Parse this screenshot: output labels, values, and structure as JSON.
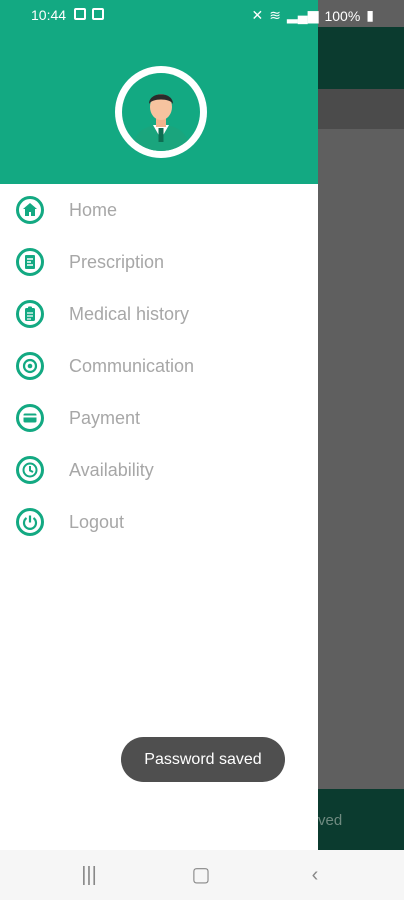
{
  "statusbar": {
    "time": "10:44",
    "battery": "100%"
  },
  "drawer": {
    "menu": [
      {
        "label": "Home",
        "icon": "home-icon"
      },
      {
        "label": "Prescription",
        "icon": "prescription-icon"
      },
      {
        "label": "Medical history",
        "icon": "medical-history-icon"
      },
      {
        "label": "Communication",
        "icon": "communication-icon"
      },
      {
        "label": "Payment",
        "icon": "payment-icon"
      },
      {
        "label": "Availability",
        "icon": "clock-icon"
      },
      {
        "label": "Logout",
        "icon": "power-icon"
      }
    ]
  },
  "toast": {
    "message": "Password saved"
  },
  "background": {
    "bottom_partial_text": "ved"
  },
  "colors": {
    "primary": "#13a982",
    "dark": "#0b3b2f",
    "scrim": "#5f5f5f"
  }
}
